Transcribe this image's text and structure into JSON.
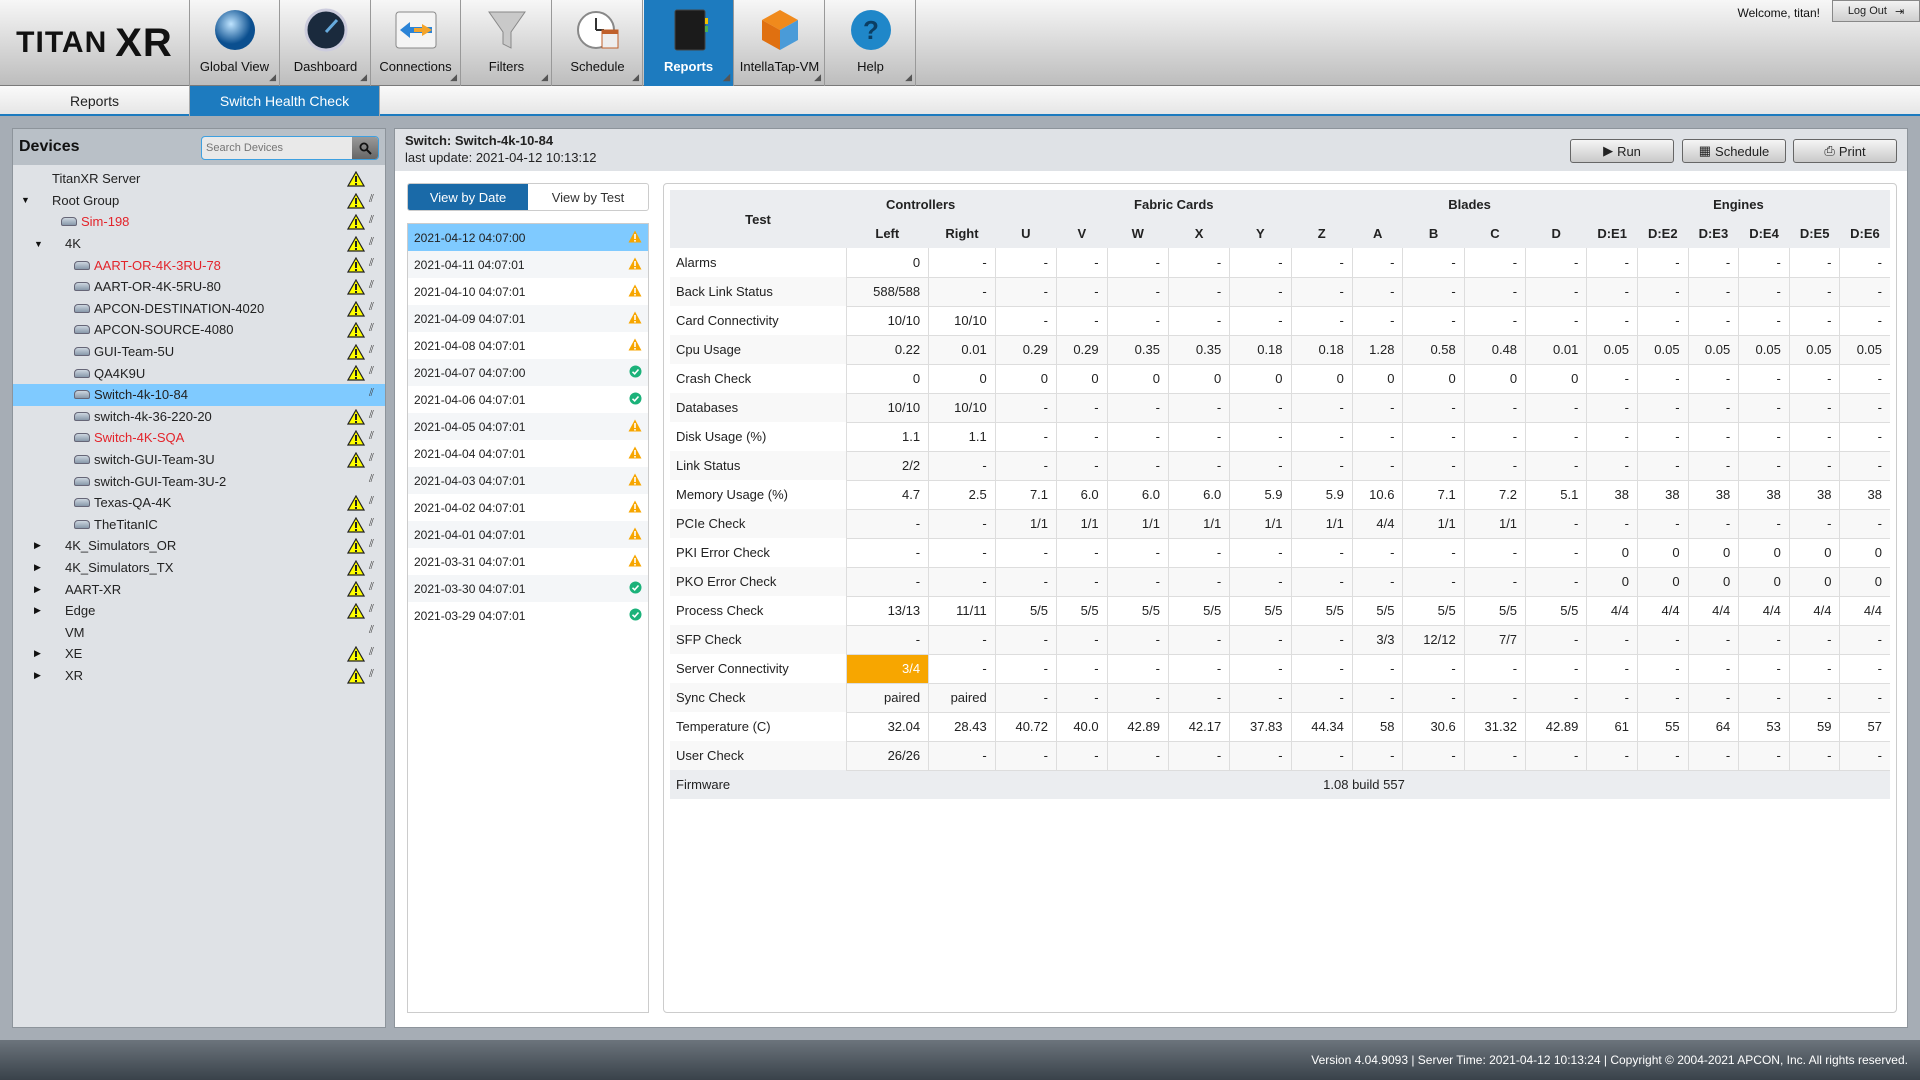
{
  "app": {
    "logo_small": "TITAN",
    "logo_big": "XR",
    "welcome": "Welcome, titan!",
    "logout": "Log Out"
  },
  "nav": [
    {
      "label": "Global View",
      "icon": "globe-icon",
      "active": false
    },
    {
      "label": "Dashboard",
      "icon": "gauge-icon",
      "active": false
    },
    {
      "label": "Connections",
      "icon": "connections-arrows-icon",
      "active": false
    },
    {
      "label": "Filters",
      "icon": "funnel-icon",
      "active": false
    },
    {
      "label": "Schedule",
      "icon": "clock-calendar-icon",
      "active": false
    },
    {
      "label": "Reports",
      "icon": "book-icon",
      "active": true
    },
    {
      "label": "IntellaTap-VM",
      "icon": "cube-icon",
      "active": false
    },
    {
      "label": "Help",
      "icon": "help-icon",
      "active": false
    }
  ],
  "subtabs": [
    {
      "label": "Reports",
      "active": false
    },
    {
      "label": "Switch Health Check",
      "active": true
    }
  ],
  "sidebar": {
    "title": "Devices",
    "search_placeholder": "Search Devices",
    "tree": [
      {
        "label": "TitanXR Server",
        "level": 0,
        "toggle": "",
        "device": false,
        "red": false,
        "warn": true,
        "grip": false
      },
      {
        "label": "Root Group",
        "level": 0,
        "toggle": "down",
        "device": false,
        "red": false,
        "warn": true,
        "grip": true
      },
      {
        "label": "Sim-198",
        "level": 1,
        "toggle": "",
        "device": true,
        "red": true,
        "warn": true,
        "grip": true
      },
      {
        "label": "4K",
        "level": 1,
        "toggle": "down",
        "device": false,
        "red": false,
        "warn": true,
        "grip": true
      },
      {
        "label": "AART-OR-4K-3RU-78",
        "level": 2,
        "toggle": "",
        "device": true,
        "red": true,
        "warn": true,
        "grip": true
      },
      {
        "label": "AART-OR-4K-5RU-80",
        "level": 2,
        "toggle": "",
        "device": true,
        "red": false,
        "warn": true,
        "grip": true
      },
      {
        "label": "APCON-DESTINATION-4020",
        "level": 2,
        "toggle": "",
        "device": true,
        "red": false,
        "warn": true,
        "grip": true
      },
      {
        "label": "APCON-SOURCE-4080",
        "level": 2,
        "toggle": "",
        "device": true,
        "red": false,
        "warn": true,
        "grip": true
      },
      {
        "label": "GUI-Team-5U",
        "level": 2,
        "toggle": "",
        "device": true,
        "red": false,
        "warn": true,
        "grip": true
      },
      {
        "label": "QA4K9U",
        "level": 2,
        "toggle": "",
        "device": true,
        "red": false,
        "warn": true,
        "grip": true
      },
      {
        "label": "Switch-4k-10-84",
        "level": 2,
        "toggle": "",
        "device": true,
        "red": false,
        "warn": false,
        "grip": true,
        "selected": true
      },
      {
        "label": "switch-4k-36-220-20",
        "level": 2,
        "toggle": "",
        "device": true,
        "red": false,
        "warn": true,
        "grip": true
      },
      {
        "label": "Switch-4K-SQA",
        "level": 2,
        "toggle": "",
        "device": true,
        "red": true,
        "warn": true,
        "grip": true
      },
      {
        "label": "switch-GUI-Team-3U",
        "level": 2,
        "toggle": "",
        "device": true,
        "red": false,
        "warn": true,
        "grip": true
      },
      {
        "label": "switch-GUI-Team-3U-2",
        "level": 2,
        "toggle": "",
        "device": true,
        "red": false,
        "warn": false,
        "grip": true
      },
      {
        "label": "Texas-QA-4K",
        "level": 2,
        "toggle": "",
        "device": true,
        "red": false,
        "warn": true,
        "grip": true
      },
      {
        "label": "TheTitanIC",
        "level": 2,
        "toggle": "",
        "device": true,
        "red": false,
        "warn": true,
        "grip": true
      },
      {
        "label": "4K_Simulators_OR",
        "level": 1,
        "toggle": "right",
        "device": false,
        "red": false,
        "warn": true,
        "grip": true
      },
      {
        "label": "4K_Simulators_TX",
        "level": 1,
        "toggle": "right",
        "device": false,
        "red": false,
        "warn": true,
        "grip": true
      },
      {
        "label": "AART-XR",
        "level": 1,
        "toggle": "right",
        "device": false,
        "red": false,
        "warn": true,
        "grip": true
      },
      {
        "label": "Edge",
        "level": 1,
        "toggle": "right",
        "device": false,
        "red": false,
        "warn": true,
        "grip": true
      },
      {
        "label": "VM",
        "level": 1,
        "toggle": "",
        "device": false,
        "red": false,
        "warn": false,
        "grip": true
      },
      {
        "label": "XE",
        "level": 1,
        "toggle": "right",
        "device": false,
        "red": false,
        "warn": true,
        "grip": true
      },
      {
        "label": "XR",
        "level": 1,
        "toggle": "right",
        "device": false,
        "red": false,
        "warn": true,
        "grip": true
      }
    ]
  },
  "main": {
    "title": "Switch: Switch-4k-10-84",
    "last_update": "last update: 2021-04-12 10:13:12",
    "buttons": {
      "run": "Run",
      "schedule": "Schedule",
      "print": "Print"
    },
    "view_tabs": [
      {
        "label": "View by Date",
        "active": true
      },
      {
        "label": "View by Test",
        "active": false
      }
    ],
    "dates": [
      {
        "date": "2021-04-12 04:07:00",
        "status": "warning",
        "selected": true
      },
      {
        "date": "2021-04-11 04:07:01",
        "status": "warning"
      },
      {
        "date": "2021-04-10 04:07:01",
        "status": "warning"
      },
      {
        "date": "2021-04-09 04:07:01",
        "status": "warning"
      },
      {
        "date": "2021-04-08 04:07:01",
        "status": "warning"
      },
      {
        "date": "2021-04-07 04:07:00",
        "status": "ok"
      },
      {
        "date": "2021-04-06 04:07:01",
        "status": "ok"
      },
      {
        "date": "2021-04-05 04:07:01",
        "status": "warning"
      },
      {
        "date": "2021-04-04 04:07:01",
        "status": "warning"
      },
      {
        "date": "2021-04-03 04:07:01",
        "status": "warning"
      },
      {
        "date": "2021-04-02 04:07:01",
        "status": "warning"
      },
      {
        "date": "2021-04-01 04:07:01",
        "status": "warning"
      },
      {
        "date": "2021-03-31 04:07:01",
        "status": "warning"
      },
      {
        "date": "2021-03-30 04:07:01",
        "status": "ok"
      },
      {
        "date": "2021-03-29 04:07:01",
        "status": "ok"
      }
    ],
    "table": {
      "test_header": "Test",
      "groups": [
        {
          "label": "Controllers",
          "span": 2
        },
        {
          "label": "Fabric Cards",
          "span": 6
        },
        {
          "label": "Blades",
          "span": 4
        },
        {
          "label": "Engines",
          "span": 6
        }
      ],
      "columns": [
        "Left",
        "Right",
        "U",
        "V",
        "W",
        "X",
        "Y",
        "Z",
        "A",
        "B",
        "C",
        "D",
        "D:E1",
        "D:E2",
        "D:E3",
        "D:E4",
        "D:E5",
        "D:E6"
      ],
      "rows": [
        {
          "test": "Alarms",
          "values": [
            "0",
            "-",
            "-",
            "-",
            "-",
            "-",
            "-",
            "-",
            "-",
            "-",
            "-",
            "-",
            "-",
            "-",
            "-",
            "-",
            "-",
            "-"
          ]
        },
        {
          "test": "Back Link Status",
          "values": [
            "588/588",
            "-",
            "-",
            "-",
            "-",
            "-",
            "-",
            "-",
            "-",
            "-",
            "-",
            "-",
            "-",
            "-",
            "-",
            "-",
            "-",
            "-"
          ]
        },
        {
          "test": "Card Connectivity",
          "values": [
            "10/10",
            "10/10",
            "-",
            "-",
            "-",
            "-",
            "-",
            "-",
            "-",
            "-",
            "-",
            "-",
            "-",
            "-",
            "-",
            "-",
            "-",
            "-"
          ]
        },
        {
          "test": "Cpu Usage",
          "values": [
            "0.22",
            "0.01",
            "0.29",
            "0.29",
            "0.35",
            "0.35",
            "0.18",
            "0.18",
            "1.28",
            "0.58",
            "0.48",
            "0.01",
            "0.05",
            "0.05",
            "0.05",
            "0.05",
            "0.05",
            "0.05"
          ]
        },
        {
          "test": "Crash Check",
          "values": [
            "0",
            "0",
            "0",
            "0",
            "0",
            "0",
            "0",
            "0",
            "0",
            "0",
            "0",
            "0",
            "-",
            "-",
            "-",
            "-",
            "-",
            "-"
          ]
        },
        {
          "test": "Databases",
          "values": [
            "10/10",
            "10/10",
            "-",
            "-",
            "-",
            "-",
            "-",
            "-",
            "-",
            "-",
            "-",
            "-",
            "-",
            "-",
            "-",
            "-",
            "-",
            "-"
          ]
        },
        {
          "test": "Disk Usage (%)",
          "values": [
            "1.1",
            "1.1",
            "-",
            "-",
            "-",
            "-",
            "-",
            "-",
            "-",
            "-",
            "-",
            "-",
            "-",
            "-",
            "-",
            "-",
            "-",
            "-"
          ]
        },
        {
          "test": "Link Status",
          "values": [
            "2/2",
            "-",
            "-",
            "-",
            "-",
            "-",
            "-",
            "-",
            "-",
            "-",
            "-",
            "-",
            "-",
            "-",
            "-",
            "-",
            "-",
            "-"
          ]
        },
        {
          "test": "Memory Usage (%)",
          "values": [
            "4.7",
            "2.5",
            "7.1",
            "6.0",
            "6.0",
            "6.0",
            "5.9",
            "5.9",
            "10.6",
            "7.1",
            "7.2",
            "5.1",
            "38",
            "38",
            "38",
            "38",
            "38",
            "38"
          ]
        },
        {
          "test": "PCIe Check",
          "values": [
            "-",
            "-",
            "1/1",
            "1/1",
            "1/1",
            "1/1",
            "1/1",
            "1/1",
            "4/4",
            "1/1",
            "1/1",
            "-",
            "-",
            "-",
            "-",
            "-",
            "-",
            "-"
          ]
        },
        {
          "test": "PKI Error Check",
          "values": [
            "-",
            "-",
            "-",
            "-",
            "-",
            "-",
            "-",
            "-",
            "-",
            "-",
            "-",
            "-",
            "0",
            "0",
            "0",
            "0",
            "0",
            "0"
          ]
        },
        {
          "test": "PKO Error Check",
          "values": [
            "-",
            "-",
            "-",
            "-",
            "-",
            "-",
            "-",
            "-",
            "-",
            "-",
            "-",
            "-",
            "0",
            "0",
            "0",
            "0",
            "0",
            "0"
          ]
        },
        {
          "test": "Process Check",
          "values": [
            "13/13",
            "11/11",
            "5/5",
            "5/5",
            "5/5",
            "5/5",
            "5/5",
            "5/5",
            "5/5",
            "5/5",
            "5/5",
            "5/5",
            "4/4",
            "4/4",
            "4/4",
            "4/4",
            "4/4",
            "4/4"
          ]
        },
        {
          "test": "SFP Check",
          "values": [
            "-",
            "-",
            "-",
            "-",
            "-",
            "-",
            "-",
            "-",
            "3/3",
            "12/12",
            "7/7",
            "-",
            "-",
            "-",
            "-",
            "-",
            "-",
            "-"
          ]
        },
        {
          "test": "Server Connectivity",
          "values": [
            "3/4",
            "-",
            "-",
            "-",
            "-",
            "-",
            "-",
            "-",
            "-",
            "-",
            "-",
            "-",
            "-",
            "-",
            "-",
            "-",
            "-",
            "-"
          ],
          "highlight": [
            0
          ]
        },
        {
          "test": "Sync Check",
          "values": [
            "paired",
            "paired",
            "-",
            "-",
            "-",
            "-",
            "-",
            "-",
            "-",
            "-",
            "-",
            "-",
            "-",
            "-",
            "-",
            "-",
            "-",
            "-"
          ]
        },
        {
          "test": "Temperature (C)",
          "values": [
            "32.04",
            "28.43",
            "40.72",
            "40.0",
            "42.89",
            "42.17",
            "37.83",
            "44.34",
            "58",
            "30.6",
            "31.32",
            "42.89",
            "61",
            "55",
            "64",
            "53",
            "59",
            "57"
          ]
        },
        {
          "test": "User Check",
          "values": [
            "26/26",
            "-",
            "-",
            "-",
            "-",
            "-",
            "-",
            "-",
            "-",
            "-",
            "-",
            "-",
            "-",
            "-",
            "-",
            "-",
            "-",
            "-"
          ]
        }
      ],
      "firmware": {
        "label": "Firmware",
        "value": "1.08 build 557"
      }
    }
  },
  "footer": "Version 4.04.9093 | Server Time: 2021-04-12 10:13:24 | Copyright © 2004-2021 APCON, Inc. All rights reserved.",
  "colors": {
    "accent": "#1d7bbf",
    "selected": "#7fcaff",
    "warning": "#f7a600",
    "ok": "#1bb27a",
    "error_text": "#e3242b"
  }
}
